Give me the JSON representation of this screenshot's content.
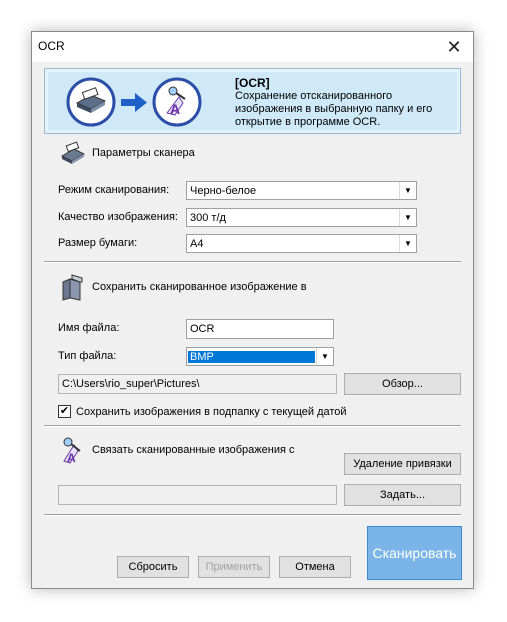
{
  "window": {
    "title": "OCR"
  },
  "banner": {
    "title": "[OCR]",
    "description": "Сохранение отсканированного изображения в выбранную папку и его открытие в программе OCR."
  },
  "scanner": {
    "heading": "Параметры сканера",
    "fields": [
      {
        "label": "Режим сканирования:",
        "value": "Черно-белое"
      },
      {
        "label": "Качество изображения:",
        "value": "300 т/д"
      },
      {
        "label": "Размер бумаги:",
        "value": "A4"
      }
    ]
  },
  "save": {
    "heading": "Сохранить сканированное изображение в",
    "filename_label": "Имя файла:",
    "filename_value": "OCR",
    "filetype_label": "Тип файла:",
    "filetype_value": "BMP",
    "path": "C:\\Users\\rio_super\\Pictures\\",
    "browse_label": "Обзор...",
    "subfolder_label": "Сохранить изображения в подпапку с текущей датой",
    "subfolder_checked": true
  },
  "link": {
    "heading": "Связать сканированные изображения с",
    "remove_label": "Удаление привязки",
    "path": "",
    "set_label": "Задать..."
  },
  "footer": {
    "reset_label": "Сбросить",
    "apply_label": "Применить",
    "cancel_label": "Отмена",
    "scan_label": "Сканировать"
  },
  "colors": {
    "accent": "#0078d7",
    "banner_bg": "#cfe9f8",
    "scan_button": "#7bb5e8"
  }
}
